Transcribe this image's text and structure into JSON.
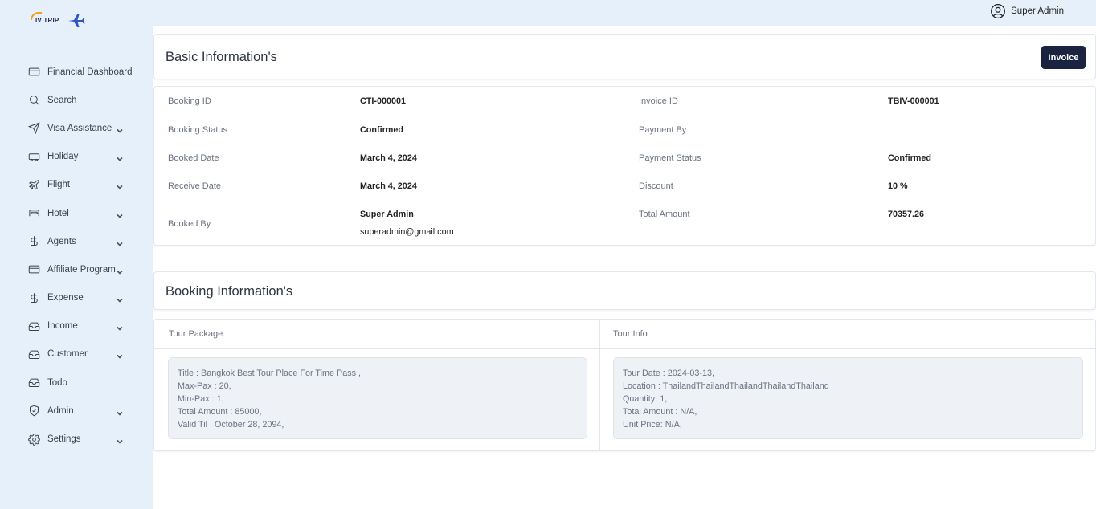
{
  "brand": {
    "logo_text": "IV TRIP"
  },
  "header": {
    "user_name": "Super Admin"
  },
  "sidebar": {
    "items": [
      {
        "label": "Financial Dashboard",
        "icon": "card-icon",
        "chevron": false
      },
      {
        "label": "Search",
        "icon": "search-icon",
        "chevron": false
      },
      {
        "label": "Visa Assistance",
        "icon": "send-icon",
        "chevron": true
      },
      {
        "label": "Holiday",
        "icon": "bus-icon",
        "chevron": true
      },
      {
        "label": "Flight",
        "icon": "plane-icon",
        "chevron": true
      },
      {
        "label": "Hotel",
        "icon": "bed-icon",
        "chevron": true
      },
      {
        "label": "Agents",
        "icon": "dollar-icon",
        "chevron": true
      },
      {
        "label": "Affiliate Program",
        "icon": "card-icon",
        "chevron": true
      },
      {
        "label": "Expense",
        "icon": "dollar-icon",
        "chevron": true
      },
      {
        "label": "Income",
        "icon": "inbox-icon",
        "chevron": true
      },
      {
        "label": "Customer",
        "icon": "inbox-icon",
        "chevron": true
      },
      {
        "label": "Todo",
        "icon": "inbox-icon",
        "chevron": false
      },
      {
        "label": "Admin",
        "icon": "shield-icon",
        "chevron": true
      },
      {
        "label": "Settings",
        "icon": "gear-icon",
        "chevron": true
      }
    ]
  },
  "basic": {
    "title": "Basic Information's",
    "invoice_button": "Invoice",
    "left": {
      "booking_id_label": "Booking ID",
      "booking_id": "CTI-000001",
      "booking_status_label": "Booking Status",
      "booking_status": "Confirmed",
      "booked_date_label": "Booked Date",
      "booked_date": "March 4, 2024",
      "receive_date_label": "Receive Date",
      "receive_date": "March 4, 2024",
      "booked_by_label": "Booked By",
      "booked_by_name": "Super Admin",
      "booked_by_email": "superadmin@gmail.com"
    },
    "right": {
      "invoice_id_label": "Invoice ID",
      "invoice_id": "TBIV-000001",
      "payment_by_label": "Payment By",
      "payment_by": "",
      "payment_status_label": "Payment Status",
      "payment_status": "Confirmed",
      "discount_label": "Discount",
      "discount": "10 %",
      "total_amount_label": "Total Amount",
      "total_amount": "70357.26"
    }
  },
  "booking": {
    "title": "Booking Information's",
    "col1_header": "Tour Package",
    "col2_header": "Tour Info",
    "package": [
      "Title : Bangkok Best Tour Place For Time Pass ,",
      "Max-Pax : 20,",
      "Min-Pax : 1,",
      "Total Amount : 85000,",
      "Valid Til : October 28, 2094,"
    ],
    "info": [
      "Tour Date : 2024-03-13,",
      "Location : ThailandThailandThailandThailandThailand",
      "Quantity: 1,",
      "Total Amount : N/A,",
      "Unit Price: N/A,"
    ]
  }
}
